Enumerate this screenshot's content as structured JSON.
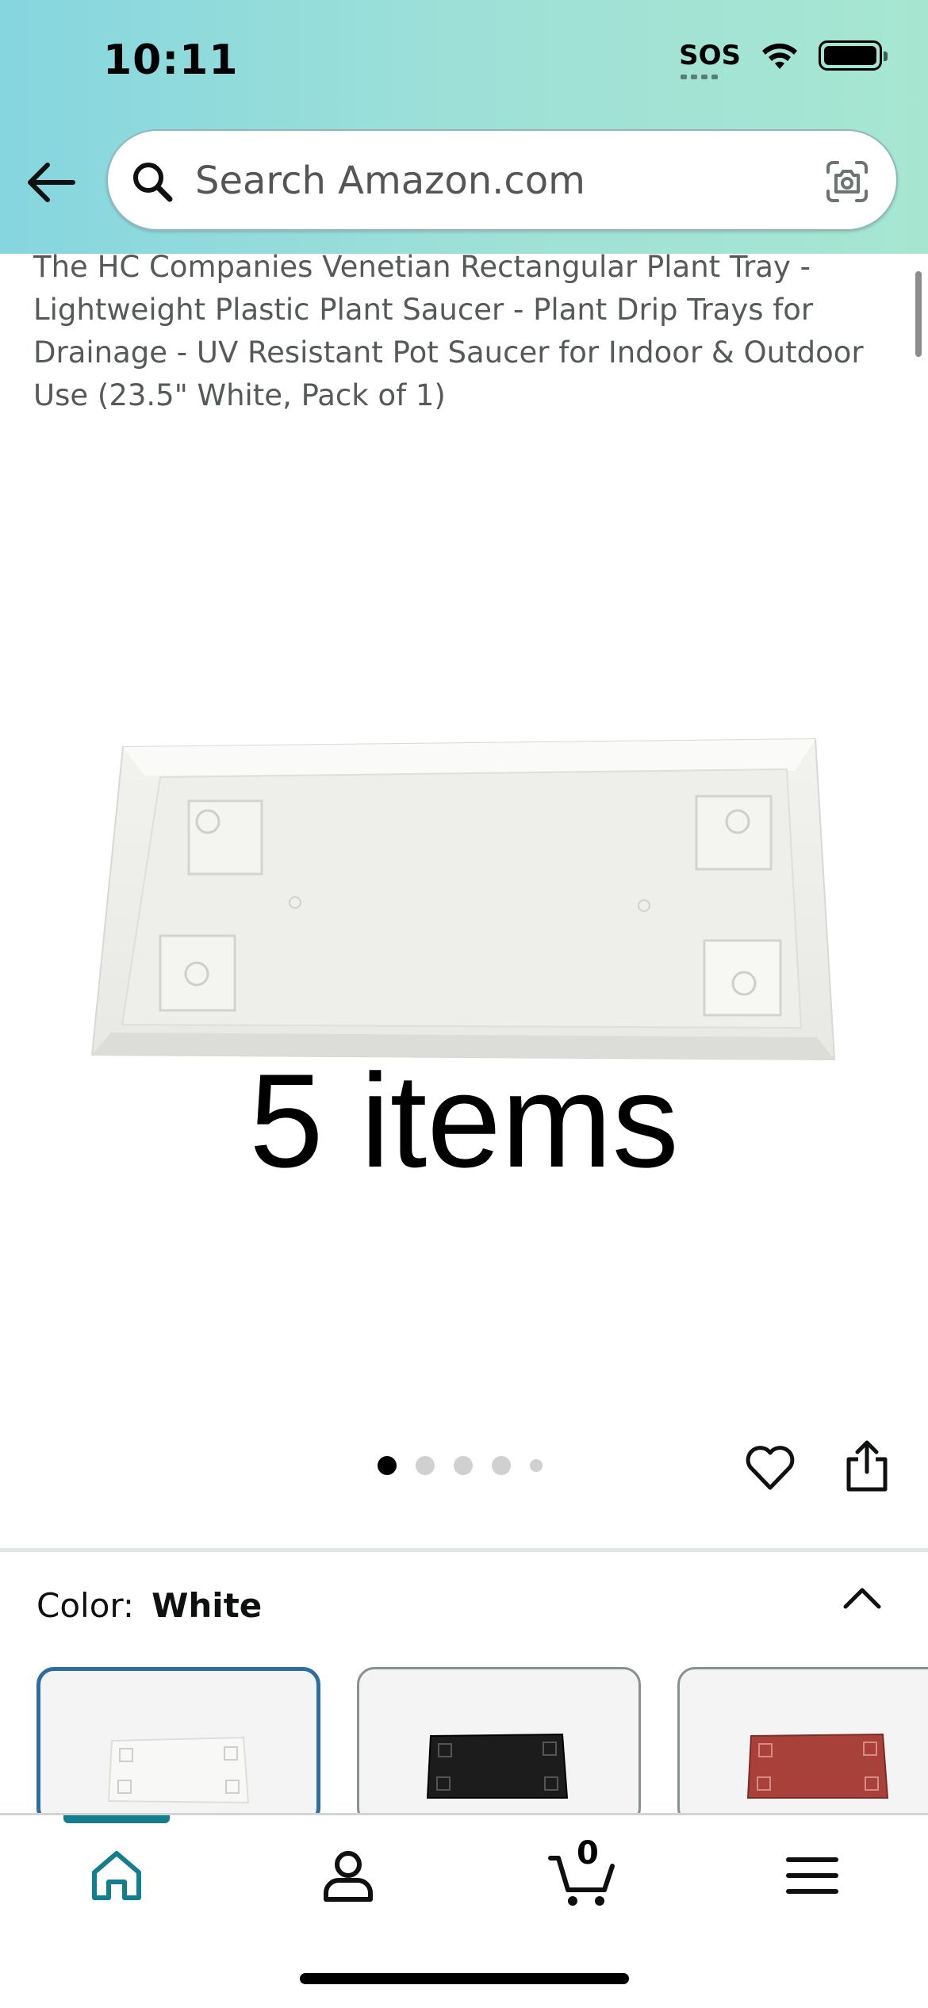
{
  "status_bar": {
    "time": "10:11",
    "sos": "SOS"
  },
  "search": {
    "placeholder": "Search Amazon.com"
  },
  "product": {
    "title": "The HC Companies Venetian Rectangular Plant Tray - Lightweight Plastic Plant Saucer - Plant Drip Trays for Drainage - UV Resistant Pot Saucer for Indoor & Outdoor Use (23.5\" White, Pack of 1)",
    "image_overlay": "5 items",
    "image_count": 5,
    "image_active_index": 0
  },
  "color_selector": {
    "label": "Color:",
    "value": "White",
    "swatches": [
      {
        "name": "White",
        "color": "#f7f7f5",
        "selected": true
      },
      {
        "name": "Black",
        "color": "#1f1f1f",
        "selected": false
      },
      {
        "name": "Terracotta",
        "color": "#a8413a",
        "selected": false
      }
    ]
  },
  "bottom_nav": {
    "cart_count": "0",
    "active_tab": "home",
    "accent_color": "#137e8e"
  }
}
